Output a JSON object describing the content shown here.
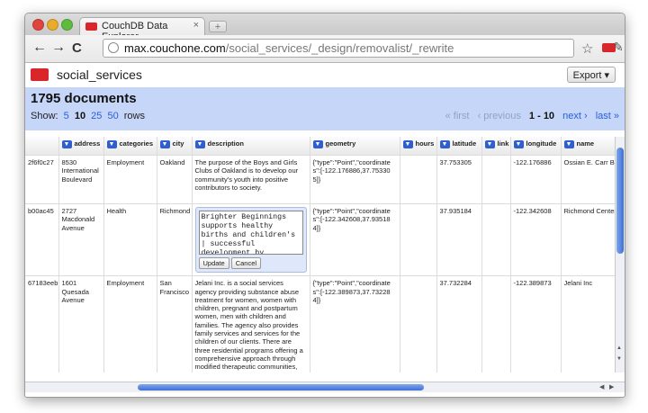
{
  "browser": {
    "tab_title": "CouchDB Data Explorer",
    "tab_close": "×",
    "new_tab": "+",
    "url_host": "max.couchone.com",
    "url_path": "/social_services/_design/removalist/_rewrite",
    "back": "←",
    "forward": "→",
    "reload": "C",
    "star": "☆",
    "wrench": "✎"
  },
  "app": {
    "db_name": "social_services",
    "export_label": "Export ▾",
    "doc_count": "1795 documents",
    "show_label": "Show:",
    "page_sizes": [
      "5",
      "10",
      "25",
      "50"
    ],
    "rows_label": "rows",
    "pager": {
      "first": "« first",
      "previous": "‹ previous",
      "range": "1 - 10",
      "next": "next ›",
      "last": "last »"
    }
  },
  "table": {
    "headers": [
      "address",
      "categories",
      "city",
      "description",
      "geometry",
      "hours",
      "latitude",
      "link",
      "longitude",
      "name"
    ],
    "dropdown_glyph": "▼",
    "rows": [
      {
        "id": "2f6f0c27",
        "address": "8530 International Boulevard",
        "categories": "Employment",
        "city": "Oakland",
        "description": "The purpose of the Boys and Girls Clubs of Oakland is to develop our community's youth into positive contributors to society.",
        "geometry": "{\"type\":\"Point\",\"coordinates\":[-122.176886,37.753305]}",
        "hours": "",
        "latitude": "37.753305",
        "link": "",
        "longitude": "-122.176886",
        "name": "Ossian E. Carr Branch"
      },
      {
        "id": "b00ac45",
        "address": "2727 Macdonald Avenue",
        "categories": "Health",
        "city": "Richmond",
        "description": "Brighter Beginnings supports healthy births and children's | successful development by partnering with",
        "geometry": "{\"type\":\"Point\",\"coordinates\":[-122.342608,37.935184]}",
        "hours": "",
        "latitude": "37.935184",
        "link": "",
        "longitude": "-122.342608",
        "name": "Richmond Center"
      },
      {
        "id": "67183eeb",
        "address": "1601 Quesada Avenue",
        "categories": "Employment",
        "city": "San Francisco",
        "description": "Jelani Inc. is a social services agency providing substance abuse treatment for women, women with children, pregnant and postpartum women, men with children and families. The agency also provides family services and services for the children of our clients. There are three residential programs offering a comprehensive approach through modified therapeutic communities, case management and after-care. Jelani Inc. believes in the right and ability of each individual to heal from substance abuse and dependence in",
        "geometry": "{\"type\":\"Point\",\"coordinates\":[-122.389873,37.732284]}",
        "hours": "",
        "latitude": "37.732284",
        "link": "",
        "longitude": "-122.389873",
        "name": "Jelani Inc"
      }
    ],
    "edit_buttons": {
      "update": "Update",
      "cancel": "Cancel"
    }
  }
}
